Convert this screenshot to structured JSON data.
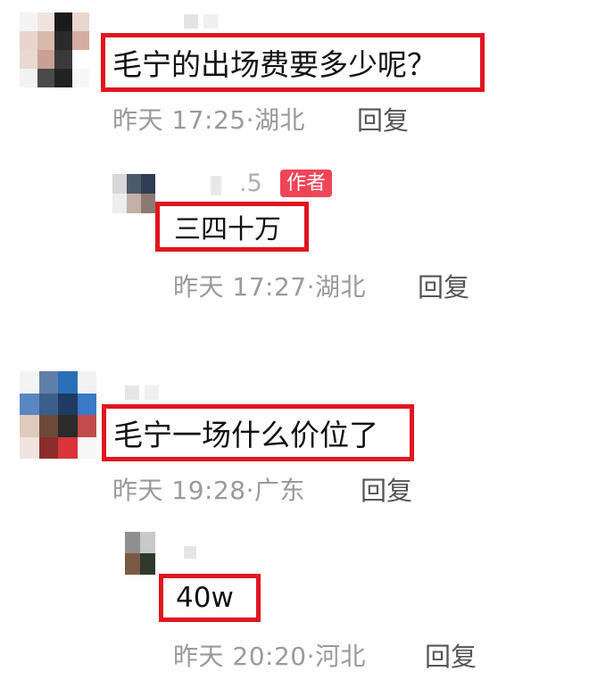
{
  "comments": [
    {
      "text": "毛宁的出场费要多少呢？",
      "time": "昨天 17:25",
      "separator": "·",
      "location": "湖北",
      "reply_label": "回复",
      "reply": {
        "nickname_tail": ".5",
        "badge": "作者",
        "text": "三四十万",
        "time": "昨天 17:27",
        "separator": "·",
        "location": "湖北",
        "reply_label": "回复"
      }
    },
    {
      "text": "毛宁一场什么价位了",
      "time": "昨天 19:28",
      "separator": "·",
      "location": "广东",
      "reply_label": "回复",
      "reply": {
        "text": "40w",
        "time": "昨天 20:20",
        "separator": "·",
        "location": "河北",
        "reply_label": "回复"
      }
    }
  ],
  "colors": {
    "highlight": "#e0151f",
    "meta_text": "#9a9a9a",
    "author_badge": "#f04457"
  }
}
